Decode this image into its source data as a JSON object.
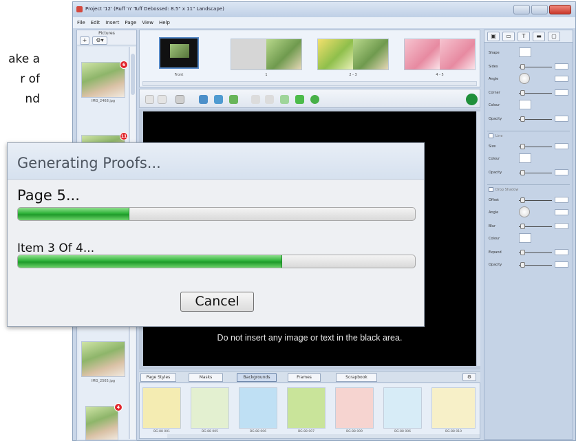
{
  "background_text": [
    "ake a",
    "r of",
    "nd"
  ],
  "window": {
    "title": "Project '12' (Ruff 'n' Tuff Debossed: 8.5\" x 11\" Landscape)",
    "menu": [
      "File",
      "Edit",
      "Insert",
      "Page",
      "View",
      "Help"
    ]
  },
  "left_panel": {
    "title": "Pictures",
    "add_label": "+",
    "options_label": "⚙▾",
    "pictures": [
      {
        "label": "IMG_2468.jpg",
        "badge": "6"
      },
      {
        "label": "",
        "badge": "11"
      },
      {
        "label": "IMG_2565.jpg",
        "badge": ""
      },
      {
        "label": "",
        "badge": "4"
      }
    ]
  },
  "page_strip": {
    "labels": [
      "Front",
      "1",
      "2 - 3",
      "4 - 5"
    ]
  },
  "canvas": {
    "note": "Do not insert any image or text in the black area."
  },
  "bottom_tabs": [
    "Page Styles",
    "Masks",
    "Backgrounds",
    "Frames",
    "Scrapbook"
  ],
  "active_tab": "Backgrounds",
  "backgrounds": {
    "labels": [
      "BG-88 001",
      "BG-88 005",
      "BG-88 006",
      "BG-88 007",
      "BG-88 009",
      "BG-88 006",
      "BG-88 010"
    ],
    "colors": [
      "#f4ecb2",
      "#e3f0d0",
      "#bfe0f4",
      "#c9e49a",
      "#f6d4d0",
      "#d7ecf7",
      "#f7f0c8"
    ]
  },
  "properties": {
    "section1": [
      "Shape",
      "Sides",
      "Angle",
      "Corner",
      "Colour",
      "Opacity"
    ],
    "section2_title": "Line",
    "section2": [
      "Size",
      "Colour",
      "Opacity"
    ],
    "section3_title": "Drop Shadow",
    "section3": [
      "Offset",
      "Angle",
      "Blur",
      "Colour",
      "Expand",
      "Opacity"
    ]
  },
  "dialog": {
    "title": "Generating Proofs...",
    "page_status": "Page 5...",
    "page_progress": 0.28,
    "item_status": "Item 3 Of 4...",
    "item_progress": 0.665,
    "cancel_label": "Cancel"
  }
}
